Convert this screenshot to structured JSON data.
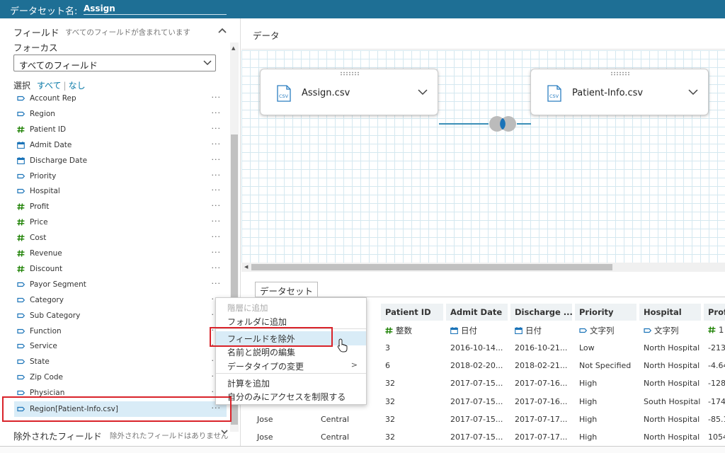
{
  "topbar": {
    "dataset_label": "データセット名:",
    "dataset_name": "Assign"
  },
  "left": {
    "fields_title": "フィールド",
    "fields_subtitle": "すべてのフィールドが含まれています",
    "focus_label": "フォーカス",
    "focus_value": "すべてのフィールド",
    "select_label": "選択",
    "select_all": "すべて",
    "select_none": "なし",
    "fields": [
      {
        "name": "Account Rep",
        "type": "string"
      },
      {
        "name": "Region",
        "type": "string"
      },
      {
        "name": "Patient ID",
        "type": "number"
      },
      {
        "name": "Admit Date",
        "type": "date"
      },
      {
        "name": "Discharge Date",
        "type": "date"
      },
      {
        "name": "Priority",
        "type": "string"
      },
      {
        "name": "Hospital",
        "type": "string"
      },
      {
        "name": "Profit",
        "type": "number"
      },
      {
        "name": "Price",
        "type": "number"
      },
      {
        "name": "Cost",
        "type": "number"
      },
      {
        "name": "Revenue",
        "type": "number"
      },
      {
        "name": "Discount",
        "type": "number"
      },
      {
        "name": "Payor Segment",
        "type": "string"
      },
      {
        "name": "Category",
        "type": "string"
      },
      {
        "name": "Sub Category",
        "type": "string"
      },
      {
        "name": "Function",
        "type": "string"
      },
      {
        "name": "Service",
        "type": "string"
      },
      {
        "name": "State",
        "type": "string"
      },
      {
        "name": "Zip Code",
        "type": "string"
      },
      {
        "name": "Physician",
        "type": "string"
      },
      {
        "name": "Region[Patient-Info.csv]",
        "type": "string",
        "selected": true
      }
    ],
    "more": "···",
    "excluded_title": "除外されたフィールド",
    "excluded_subtitle": "除外されたフィールドはありません"
  },
  "right": {
    "data_title": "データ",
    "node1": "Assign.csv",
    "node2": "Patient-Info.csv",
    "csv_badge": "CSV",
    "dataset_tab": "データセット"
  },
  "table": {
    "columns": [
      {
        "header": "Patient ID",
        "type": "整数",
        "icon": "number"
      },
      {
        "header": "Admit Date",
        "type": "日付",
        "icon": "date"
      },
      {
        "header": "Discharge ...",
        "type": "日付",
        "icon": "date"
      },
      {
        "header": "Priority",
        "type": "文字列",
        "icon": "string"
      },
      {
        "header": "Hospital",
        "type": "文字列",
        "icon": "string"
      },
      {
        "header": "Prof",
        "type": "1",
        "icon": "number"
      }
    ],
    "rows": [
      [
        "",
        "",
        "3",
        "2016-10-14...",
        "2016-10-21...",
        "Low",
        "North Hospital",
        "-213"
      ],
      [
        "",
        "",
        "6",
        "2018-02-20...",
        "2018-02-21...",
        "Not Specified",
        "North Hospital",
        "-4.64"
      ],
      [
        "",
        "",
        "32",
        "2017-07-15...",
        "2017-07-16...",
        "High",
        "North Hospital",
        "-128"
      ],
      [
        "",
        "",
        "32",
        "2017-07-15...",
        "2017-07-16...",
        "High",
        "South Hospital",
        "-174"
      ],
      [
        "Jose",
        "Central",
        "32",
        "2017-07-15...",
        "2017-07-17...",
        "High",
        "North Hospital",
        "-85.1"
      ],
      [
        "Jose",
        "Central",
        "32",
        "2017-07-15...",
        "2017-07-17...",
        "High",
        "North Hospital",
        "1054"
      ]
    ]
  },
  "context_menu": {
    "items": [
      {
        "label": "階層に追加",
        "disabled": true
      },
      {
        "label": "フォルダに追加"
      },
      {
        "label": "フィールドを除外",
        "highlighted": true
      },
      {
        "label": "名前と説明の編集"
      },
      {
        "label": "データタイプの変更",
        "submenu": true
      },
      {
        "label": "計算を追加"
      },
      {
        "label": "自分のみにアクセスを制限する"
      }
    ],
    "submenu_arrow": ">"
  },
  "colors": {
    "topbar": "#1e6f95",
    "accent": "#0a7aa8",
    "highlight": "#d9232a",
    "number_icon": "#1d8102"
  }
}
